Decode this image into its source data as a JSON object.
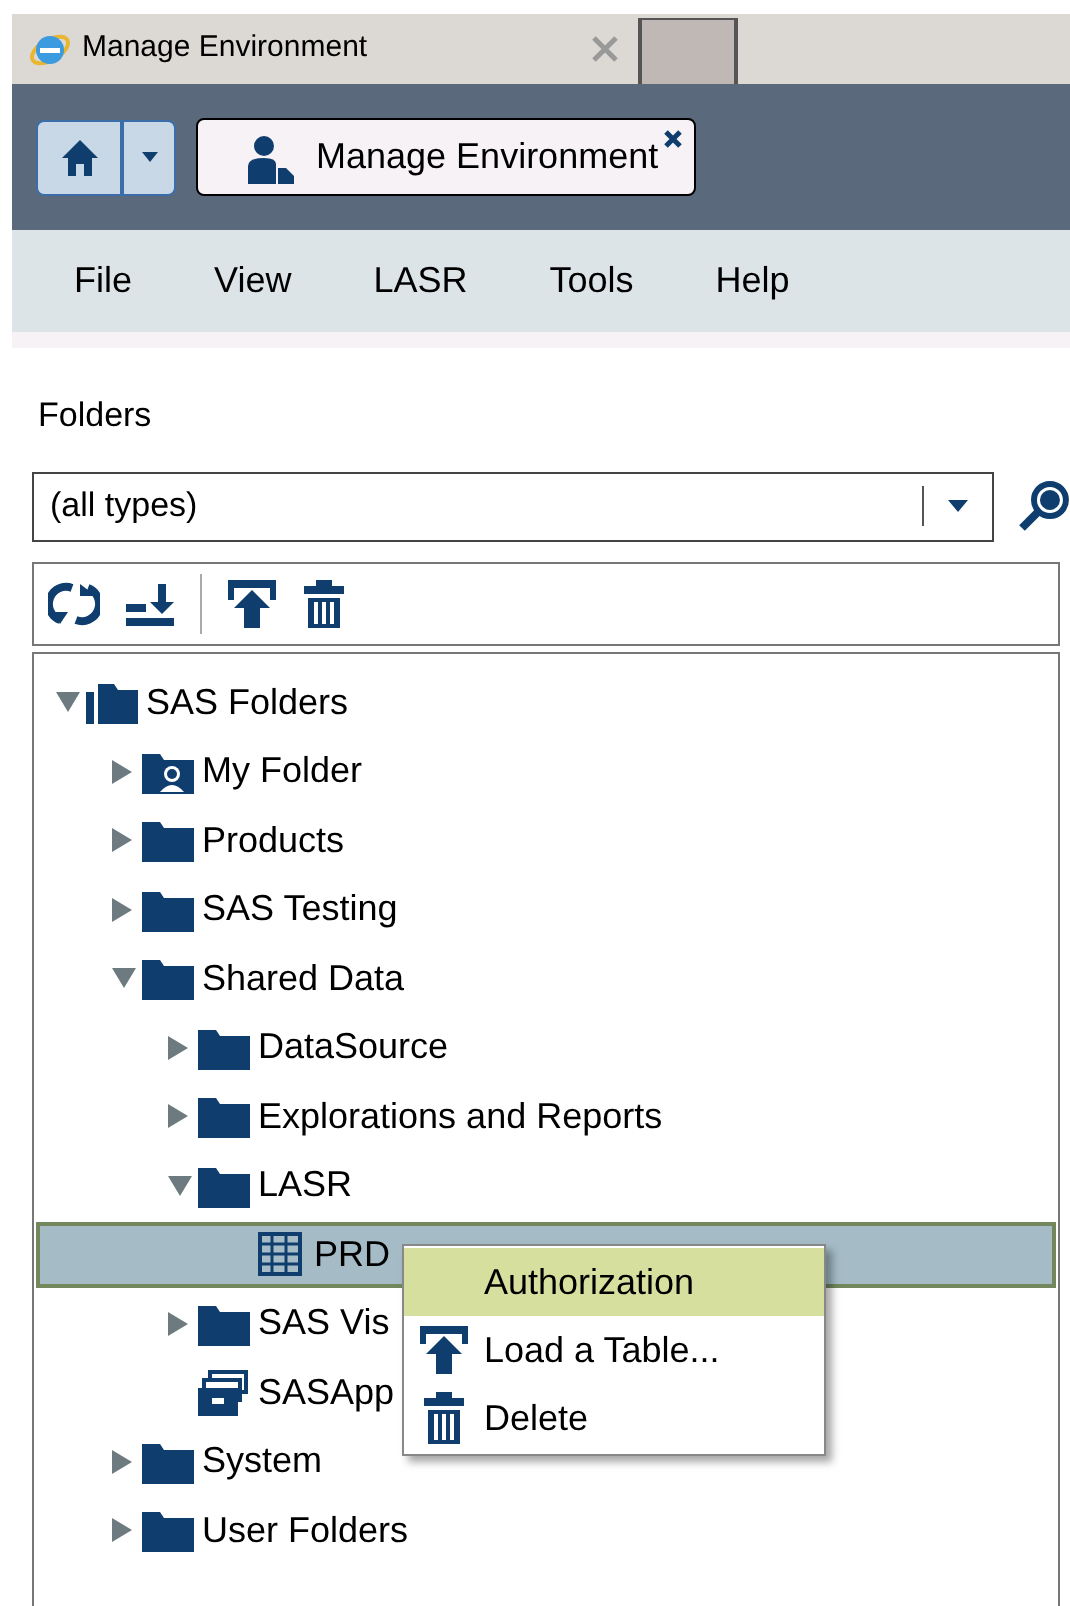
{
  "browser_tab": {
    "title": "Manage Environment"
  },
  "app_tab": {
    "title": "Manage Environment"
  },
  "menu_bar": [
    "File",
    "View",
    "LASR",
    "Tools",
    "Help"
  ],
  "panel": {
    "title": "Folders"
  },
  "type_filter": {
    "value": "(all types)"
  },
  "tree": [
    {
      "label": "SAS Folders",
      "kind": "root",
      "expanded": true,
      "selected": false,
      "children": [
        {
          "label": "My Folder",
          "kind": "user-folder",
          "expanded": false,
          "selected": false
        },
        {
          "label": "Products",
          "kind": "folder",
          "expanded": false,
          "selected": false
        },
        {
          "label": "SAS Testing",
          "kind": "folder",
          "expanded": false,
          "selected": false
        },
        {
          "label": "Shared Data",
          "kind": "folder",
          "expanded": true,
          "selected": false,
          "children": [
            {
              "label": "DataSource",
              "kind": "folder",
              "expanded": false,
              "selected": false
            },
            {
              "label": "Explorations and Reports",
              "kind": "folder",
              "expanded": false,
              "selected": false
            },
            {
              "label": "LASR",
              "kind": "folder",
              "expanded": true,
              "selected": false,
              "children": [
                {
                  "label": "PRD",
                  "kind": "table",
                  "selected": true
                }
              ]
            },
            {
              "label": "SAS Vis",
              "kind": "folder",
              "expanded": false,
              "selected": false
            },
            {
              "label": "SASApp",
              "kind": "server",
              "selected": false
            }
          ]
        },
        {
          "label": "System",
          "kind": "folder",
          "expanded": false,
          "selected": false
        },
        {
          "label": "User Folders",
          "kind": "folder",
          "expanded": false,
          "selected": false
        }
      ]
    }
  ],
  "context_menu": [
    {
      "label": "Authorization",
      "kind": "none",
      "selected": true
    },
    {
      "label": "Load a Table...",
      "kind": "load",
      "selected": false
    },
    {
      "label": "Delete",
      "kind": "delete",
      "selected": false
    }
  ]
}
